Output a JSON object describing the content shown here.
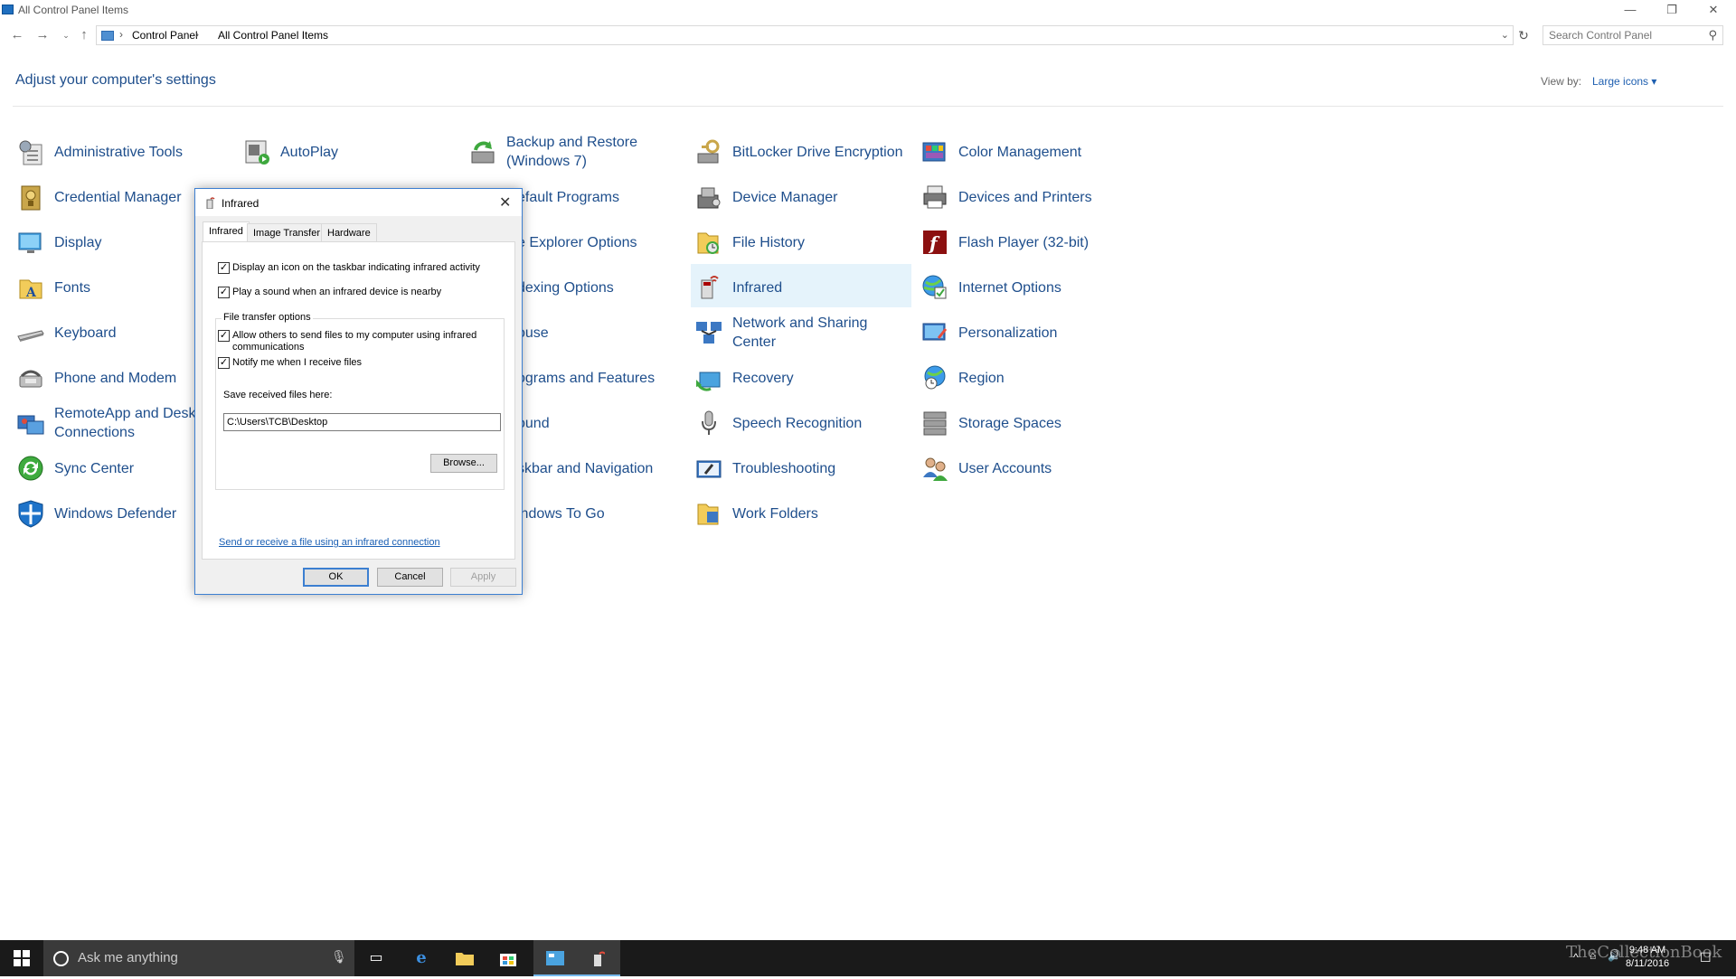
{
  "window": {
    "title": "All Control Panel Items",
    "minimize": "—",
    "restore": "❐",
    "close": "✕"
  },
  "address": {
    "crumbs": [
      "Control Panel",
      "All Control Panel Items"
    ],
    "separator": "›",
    "search_placeholder": "Search Control Panel"
  },
  "header": {
    "title": "Adjust your computer's settings",
    "view_by_label": "View by:",
    "view_by_value": "Large icons ▾"
  },
  "items": [
    {
      "label": "Administrative Tools"
    },
    {
      "label": "AutoPlay"
    },
    {
      "label": "Backup and Restore (Windows 7)"
    },
    {
      "label": "BitLocker Drive Encryption"
    },
    {
      "label": "Color Management"
    },
    {
      "label": "Credential Manager"
    },
    {
      "label": "Default Programs"
    },
    {
      "label": "Device Manager"
    },
    {
      "label": "Devices and Printers"
    },
    {
      "label": "Display"
    },
    {
      "label": "File Explorer Options"
    },
    {
      "label": "File History"
    },
    {
      "label": "Flash Player (32-bit)"
    },
    {
      "label": "Fonts"
    },
    {
      "label": "Indexing Options"
    },
    {
      "label": "Infrared"
    },
    {
      "label": "Internet Options"
    },
    {
      "label": "Keyboard"
    },
    {
      "label": "Mouse"
    },
    {
      "label": "Network and Sharing Center"
    },
    {
      "label": "Personalization"
    },
    {
      "label": "Phone and Modem"
    },
    {
      "label": "Programs and Features"
    },
    {
      "label": "Recovery"
    },
    {
      "label": "Region"
    },
    {
      "label": "RemoteApp and Desktop Connections"
    },
    {
      "label": "Sound"
    },
    {
      "label": "Speech Recognition"
    },
    {
      "label": "Storage Spaces"
    },
    {
      "label": "Sync Center"
    },
    {
      "label": "Taskbar and Navigation"
    },
    {
      "label": "Troubleshooting"
    },
    {
      "label": "User Accounts"
    },
    {
      "label": "Windows Defender"
    },
    {
      "label": "Windows To Go"
    },
    {
      "label": "Work Folders"
    }
  ],
  "visible_labels": {
    "admin": "Administrative Tools",
    "autoplay": "AutoPlay",
    "backup1": "Backup and Restore",
    "backup2": "(Windows 7)",
    "bitlocker": "BitLocker Drive Encryption",
    "color": "Color Management",
    "cred": "Credential Manager",
    "defprog": "efault Programs",
    "devmgr": "Device Manager",
    "devprn": "Devices and Printers",
    "display": "Display",
    "fileexp": "e Explorer Options",
    "filehist": "File History",
    "flash": "Flash Player (32-bit)",
    "fonts": "Fonts",
    "index": "dexing Options",
    "infrared": "Infrared",
    "inet": "Internet Options",
    "keyboard": "Keyboard",
    "mouse": "ouse",
    "network1": "Network and Sharing",
    "network2": "Center",
    "person": "Personalization",
    "phone": "Phone and Modem",
    "programs": "ograms and Features",
    "recovery": "Recovery",
    "region": "Region",
    "remote1": "RemoteApp and Deskt",
    "remote2": "Connections",
    "sound": "ound",
    "speech": "Speech Recognition",
    "storage": "Storage Spaces",
    "sync": "Sync Center",
    "taskbar": "skbar and Navigation",
    "trouble": "Troubleshooting",
    "users": "User Accounts",
    "defender": "Windows Defender",
    "wtg": "indows To Go",
    "work": "Work Folders"
  },
  "dialog": {
    "title": "Infrared",
    "tabs": [
      "Infrared",
      "Image Transfer",
      "Hardware"
    ],
    "check1": "Display an icon on the taskbar indicating infrared activity",
    "check2": "Play a sound when an infrared device is nearby",
    "group_label": "File transfer options",
    "check3a": "Allow others to send files to my computer using infrared",
    "check3b": "communications",
    "check4": "Notify me when I receive files",
    "save_label": "Save received files here:",
    "save_path": "C:\\Users\\TCB\\Desktop",
    "browse": "Browse...",
    "link": "Send or receive a file using an infrared connection",
    "ok": "OK",
    "cancel": "Cancel",
    "apply": "Apply",
    "checkmark": "✓"
  },
  "taskbar": {
    "search_placeholder": "Ask me anything",
    "time": "9:48 AM",
    "date": "8/11/2016",
    "watermark": "TheCollectionBook"
  }
}
